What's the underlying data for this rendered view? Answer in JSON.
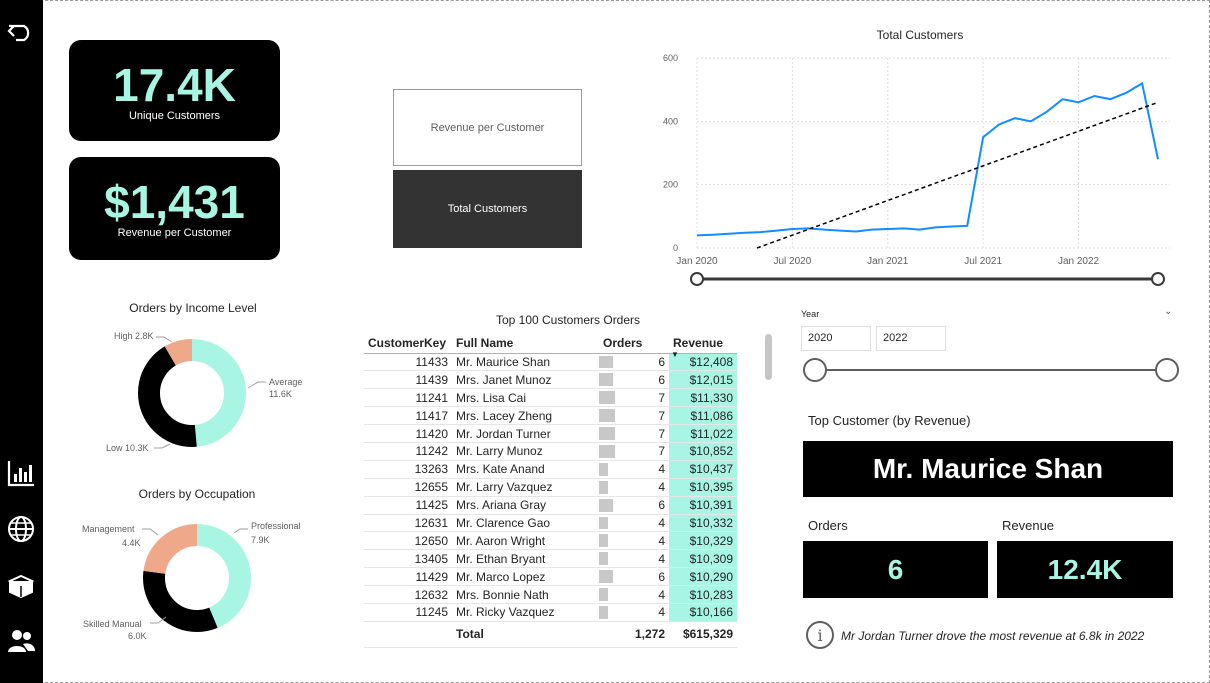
{
  "nav": {
    "back_icon": "back-arrow-icon",
    "icons": [
      "bar-chart-icon",
      "globe-icon",
      "box-icon",
      "users-icon"
    ]
  },
  "kpi": {
    "customers": {
      "value": "17.4K",
      "label": "Unique Customers"
    },
    "revenue": {
      "value": "$1,431",
      "label": "Revenue per Customer"
    }
  },
  "toggle": {
    "rev_label": "Revenue per Customer",
    "tot_label": "Total Customers"
  },
  "line_chart": {
    "title": "Total Customers",
    "y_ticks": [
      "600",
      "400",
      "200",
      "0"
    ],
    "x_ticks": [
      "Jan 2020",
      "Jul 2020",
      "Jan 2021",
      "Jul 2021",
      "Jan 2022"
    ]
  },
  "donut_income": {
    "title": "Orders by Income Level",
    "labels": [
      {
        "name": "High",
        "value": "2.8K"
      },
      {
        "name": "Average",
        "value": "11.6K"
      },
      {
        "name": "Low",
        "value": "10.3K"
      }
    ]
  },
  "donut_occ": {
    "title": "Orders by Occupation",
    "labels": [
      {
        "name": "Professional",
        "value": "7.9K"
      },
      {
        "name": "Management",
        "value": "4.4K"
      },
      {
        "name": "Skilled Manual",
        "value": "6.0K"
      }
    ]
  },
  "table": {
    "title": "Top 100 Customers Orders",
    "headers": [
      "CustomerKey",
      "Full Name",
      "Orders",
      "Revenue"
    ],
    "rows": [
      [
        "11433",
        "Mr. Maurice Shan",
        "6",
        "$12,408"
      ],
      [
        "11439",
        "Mrs. Janet Munoz",
        "6",
        "$12,015"
      ],
      [
        "11241",
        "Mrs. Lisa Cai",
        "7",
        "$11,330"
      ],
      [
        "11417",
        "Mrs. Lacey Zheng",
        "7",
        "$11,086"
      ],
      [
        "11420",
        "Mr. Jordan Turner",
        "7",
        "$11,022"
      ],
      [
        "11242",
        "Mr. Larry Munoz",
        "7",
        "$10,852"
      ],
      [
        "13263",
        "Mrs. Kate Anand",
        "4",
        "$10,437"
      ],
      [
        "12655",
        "Mr. Larry Vazquez",
        "4",
        "$10,395"
      ],
      [
        "11425",
        "Mrs. Ariana Gray",
        "6",
        "$10,391"
      ],
      [
        "12631",
        "Mr. Clarence Gao",
        "4",
        "$10,332"
      ],
      [
        "12650",
        "Mr. Aaron Wright",
        "4",
        "$10,329"
      ],
      [
        "13405",
        "Mr. Ethan Bryant",
        "4",
        "$10,309"
      ],
      [
        "11429",
        "Mr. Marco Lopez",
        "6",
        "$10,290"
      ],
      [
        "12632",
        "Mrs. Bonnie Nath",
        "4",
        "$10,283"
      ],
      [
        "11245",
        "Mr. Ricky Vazquez",
        "4",
        "$10,166"
      ]
    ],
    "total": {
      "label": "Total",
      "orders": "1,272",
      "revenue": "$615,329"
    }
  },
  "year_slicer": {
    "label": "Year",
    "from": "2020",
    "to": "2022"
  },
  "top_customer": {
    "title": "Top Customer (by Revenue)",
    "name": "Mr. Maurice Shan",
    "orders_label": "Orders",
    "orders": "6",
    "revenue_label": "Revenue",
    "revenue": "12.4K"
  },
  "insight": "Mr Jordan Turner drove the most revenue at 6.8k in 2022",
  "chart_data": {
    "type": "line",
    "title": "Total Customers",
    "ylim": [
      0,
      600
    ],
    "x": [
      "Jan 2020",
      "Feb 2020",
      "Mar 2020",
      "Apr 2020",
      "May 2020",
      "Jun 2020",
      "Jul 2020",
      "Aug 2020",
      "Sep 2020",
      "Oct 2020",
      "Nov 2020",
      "Dec 2020",
      "Jan 2021",
      "Feb 2021",
      "Mar 2021",
      "Apr 2021",
      "May 2021",
      "Jun 2021",
      "Jul 2021",
      "Aug 2021",
      "Sep 2021",
      "Oct 2021",
      "Nov 2021",
      "Dec 2021",
      "Jan 2022",
      "Feb 2022",
      "Mar 2022",
      "Apr 2022",
      "May 2022",
      "Jun 2022"
    ],
    "series": [
      {
        "values": [
          40,
          42,
          45,
          48,
          50,
          55,
          60,
          62,
          58,
          55,
          52,
          58,
          60,
          62,
          58,
          65,
          68,
          70,
          350,
          390,
          410,
          400,
          430,
          470,
          460,
          480,
          470,
          490,
          520,
          280
        ]
      }
    ],
    "trendline": true
  },
  "colors": {
    "accent": "#a8f5e4",
    "line": "#118dff",
    "donut_salmon": "#f0a88a",
    "black": "#000000"
  }
}
